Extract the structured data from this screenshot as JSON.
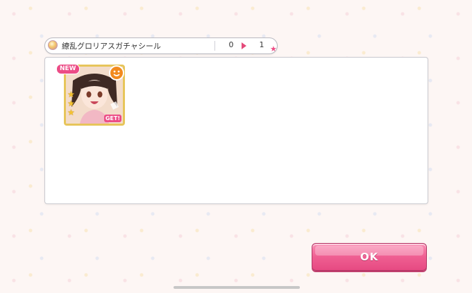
{
  "item_bar": {
    "icon": "sticker-icon",
    "name": "繚乱グロリアスガチャシール",
    "count_before": "0",
    "count_after": "1"
  },
  "card": {
    "new_badge": "NEW",
    "get_badge": "GET!",
    "attribute_icon": "smiley-icon",
    "rarity_stars": 3,
    "frame_color": "#e7c55a"
  },
  "ok_button": {
    "label": "OK"
  },
  "colors": {
    "accent_pink": "#ec4c86",
    "attribute_orange": "#f28a1e",
    "background": "#fdf6f4"
  }
}
